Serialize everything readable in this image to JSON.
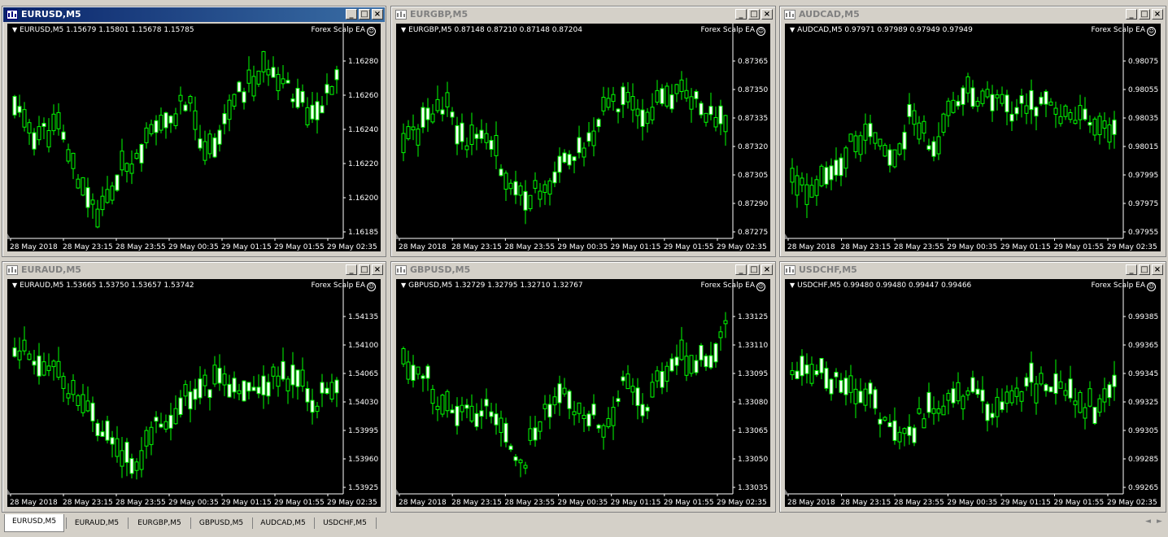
{
  "colors": {
    "candle": "#00ff00",
    "bg": "#000000",
    "text": "#ffffff",
    "trade_line": "#ff0000",
    "buy_arrow": "#3a6bff"
  },
  "charts": [
    {
      "id": "w1",
      "title": "EURUSD,M5",
      "active": true,
      "info": "EURUSD,M5  1.15679 1.15801 1.15678 1.15785",
      "ea": "Forex Scalp EA",
      "prices": [
        "1.16280",
        "1.16260",
        "1.16240",
        "1.16220",
        "1.16200",
        "1.16185"
      ],
      "times": [
        "28 May 2018",
        "28 May 23:15",
        "28 May 23:55",
        "29 May 00:35",
        "29 May 01:15",
        "29 May 01:55",
        "29 May 02:35"
      ],
      "seed": 11,
      "shape": [
        0.7,
        0.55,
        0.6,
        0.3,
        0.1,
        0.35,
        0.5,
        0.6,
        0.75,
        0.45,
        0.7,
        0.85,
        0.95,
        0.8,
        0.65,
        0.85
      ]
    },
    {
      "id": "w2",
      "title": "EURGBP,M5",
      "active": false,
      "info": "EURGBP,M5  0.87148 0.87210 0.87148 0.87204",
      "ea": "Forex Scalp EA",
      "prices": [
        "0.87365",
        "0.87350",
        "0.87335",
        "0.87320",
        "0.87305",
        "0.87290",
        "0.87275"
      ],
      "times": [
        "28 May 2018",
        "28 May 23:15",
        "28 May 23:55",
        "29 May 00:35",
        "29 May 01:15",
        "29 May 01:55",
        "29 May 02:35"
      ],
      "seed": 23,
      "shape": [
        0.55,
        0.6,
        0.75,
        0.5,
        0.6,
        0.35,
        0.2,
        0.25,
        0.45,
        0.5,
        0.7,
        0.75,
        0.7,
        0.75,
        0.8,
        0.7,
        0.65
      ]
    },
    {
      "id": "w3",
      "title": "AUDCAD,M5",
      "active": false,
      "info": "AUDCAD,M5  0.97971 0.97989 0.97949 0.97949",
      "ea": "Forex Scalp EA",
      "prices": [
        "0.98075",
        "0.98055",
        "0.98035",
        "0.98015",
        "0.97995",
        "0.97975",
        "0.97955"
      ],
      "times": [
        "28 May 2018",
        "28 May 23:15",
        "28 May 23:55",
        "29 May 00:35",
        "29 May 01:15",
        "29 May 01:55",
        "29 May 02:35"
      ],
      "seed": 37,
      "shape": [
        0.3,
        0.2,
        0.35,
        0.5,
        0.6,
        0.4,
        0.7,
        0.45,
        0.75,
        0.8,
        0.75,
        0.7,
        0.72,
        0.7,
        0.68,
        0.65,
        0.6
      ]
    },
    {
      "id": "w4",
      "title": "EURAUD,M5",
      "active": false,
      "info": "EURAUD,M5  1.53665 1.53750 1.53657 1.53742",
      "ea": "Forex Scalp EA",
      "prices": [
        "1.54135",
        "1.54100",
        "1.54065",
        "1.54030",
        "1.53995",
        "1.53960",
        "1.53925"
      ],
      "times": [
        "28 May 2018",
        "28 May 23:15",
        "28 May 23:55",
        "29 May 00:35",
        "29 May 01:15",
        "29 May 01:55",
        "29 May 02:35"
      ],
      "seed": 51,
      "shape": [
        0.8,
        0.7,
        0.65,
        0.5,
        0.4,
        0.2,
        0.15,
        0.35,
        0.45,
        0.55,
        0.6,
        0.6,
        0.55,
        0.65,
        0.6,
        0.5,
        0.55
      ]
    },
    {
      "id": "w5",
      "title": "GBPUSD,M5",
      "active": false,
      "info": "GBPUSD,M5  1.32729 1.32795 1.32710 1.32767",
      "ea": "Forex Scalp EA",
      "prices": [
        "1.33125",
        "1.33110",
        "1.33095",
        "1.33080",
        "1.33065",
        "1.33050",
        "1.33035"
      ],
      "times": [
        "28 May 2018",
        "28 May 23:15",
        "28 May 23:55",
        "29 May 00:35",
        "29 May 01:15",
        "29 May 01:55",
        "29 May 02:35"
      ],
      "seed": 67,
      "shape": [
        0.7,
        0.65,
        0.45,
        0.4,
        0.45,
        0.3,
        0.15,
        0.45,
        0.5,
        0.45,
        0.35,
        0.6,
        0.45,
        0.7,
        0.75,
        0.7,
        0.9
      ]
    },
    {
      "id": "w6",
      "title": "USDCHF,M5",
      "active": false,
      "info": "USDCHF,M5  0.99480 0.99480 0.99447 0.99466",
      "ea": "Forex Scalp EA",
      "prices": [
        "0.99385",
        "0.99365",
        "0.99345",
        "0.99325",
        "0.99305",
        "0.99285",
        "0.99265"
      ],
      "times": [
        "28 May 2018",
        "28 May 23:15",
        "28 May 23:55",
        "29 May 00:35",
        "29 May 01:15",
        "29 May 01:55",
        "29 May 02:35"
      ],
      "seed": 83,
      "shape": [
        0.65,
        0.7,
        0.6,
        0.55,
        0.5,
        0.3,
        0.35,
        0.45,
        0.5,
        0.55,
        0.4,
        0.55,
        0.6,
        0.55,
        0.5,
        0.45,
        0.55
      ]
    }
  ],
  "tabs": [
    "EURUSD,M5",
    "EURAUD,M5",
    "EURGBP,M5",
    "GBPUSD,M5",
    "AUDCAD,M5",
    "USDCHF,M5"
  ]
}
